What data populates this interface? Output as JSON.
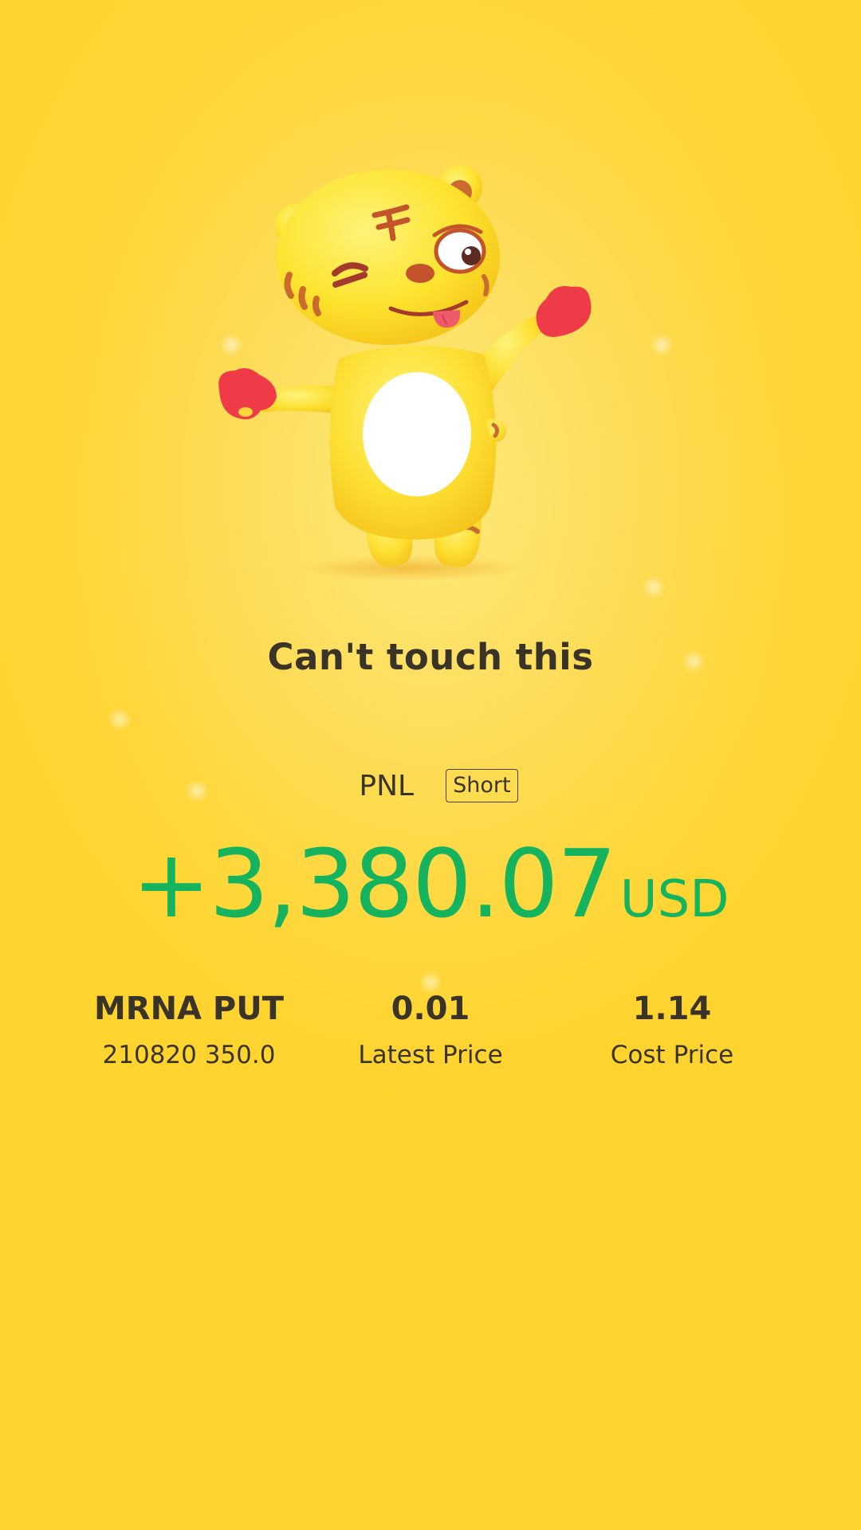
{
  "headline": "Can't touch this",
  "pnl": {
    "label": "PNL",
    "badge": "Short",
    "value": "+3,380.07",
    "unit": "USD",
    "value_color": "#16b35f"
  },
  "contract": {
    "symbol": "MRNA PUT",
    "detail": "210820 350.0"
  },
  "latest": {
    "value": "0.01",
    "label": "Latest Price"
  },
  "cost": {
    "value": "1.14",
    "label": "Cost Price"
  },
  "mascot": {
    "icon": "tiger-mascot-icon"
  },
  "colors": {
    "background": "#fed636",
    "gain": "#16b35f",
    "text": "#3a3428"
  }
}
